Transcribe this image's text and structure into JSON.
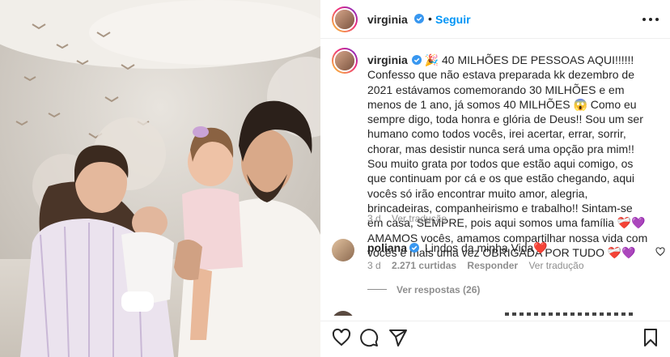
{
  "post": {
    "author": "virginia",
    "follow_label": "Seguir",
    "separator": "•"
  },
  "caption": {
    "author": "virginia",
    "text": "🎉 40 MILHÕES DE PESSOAS AQUI!!!!!! Confesso que não estava preparada kk dezembro de 2021 estávamos comemorando 30 MILHÕES e em menos de 1 ano, já somos 40 MILHÕES 😱 Como eu sempre digo, toda honra e glória de Deus!! Sou um ser humano como todos vocês, irei acertar, errar, sorrir, chorar, mas desistir nunca será uma opção pra mim!! Sou muito grata por todos que estão aqui comigo, os que continuam por cá e os que estão chegando, aqui vocês só irão encontrar muito amor, alegria, brincadeiras, companheirismo e trabalho!! Sintam-se em casa, SEMPRE, pois aqui somos uma família ❤️‍🩹💜 AMAMOS vocês, amamos compartilhar nossa vida com vocês e mais uma vez OBRIGADA POR TUDO ❤️‍🩹💜",
    "time": "3 d",
    "translate_label": "Ver tradução"
  },
  "comment": {
    "author": "poliana",
    "text": "Lindos da minha Vida❤️",
    "time": "3 d",
    "likes": "2.271 curtidas",
    "reply_label": "Responder",
    "translate_label": "Ver tradução"
  },
  "replies": {
    "label": "Ver respostas (26)"
  },
  "icons": {
    "like": "heart-icon",
    "comment": "comment-icon",
    "share": "share-icon",
    "save": "bookmark-icon",
    "more": "more-icon",
    "verified": "verified-icon"
  },
  "colors": {
    "link": "#0095f6",
    "verified": "#3897f0",
    "muted": "#8e8e8e"
  }
}
